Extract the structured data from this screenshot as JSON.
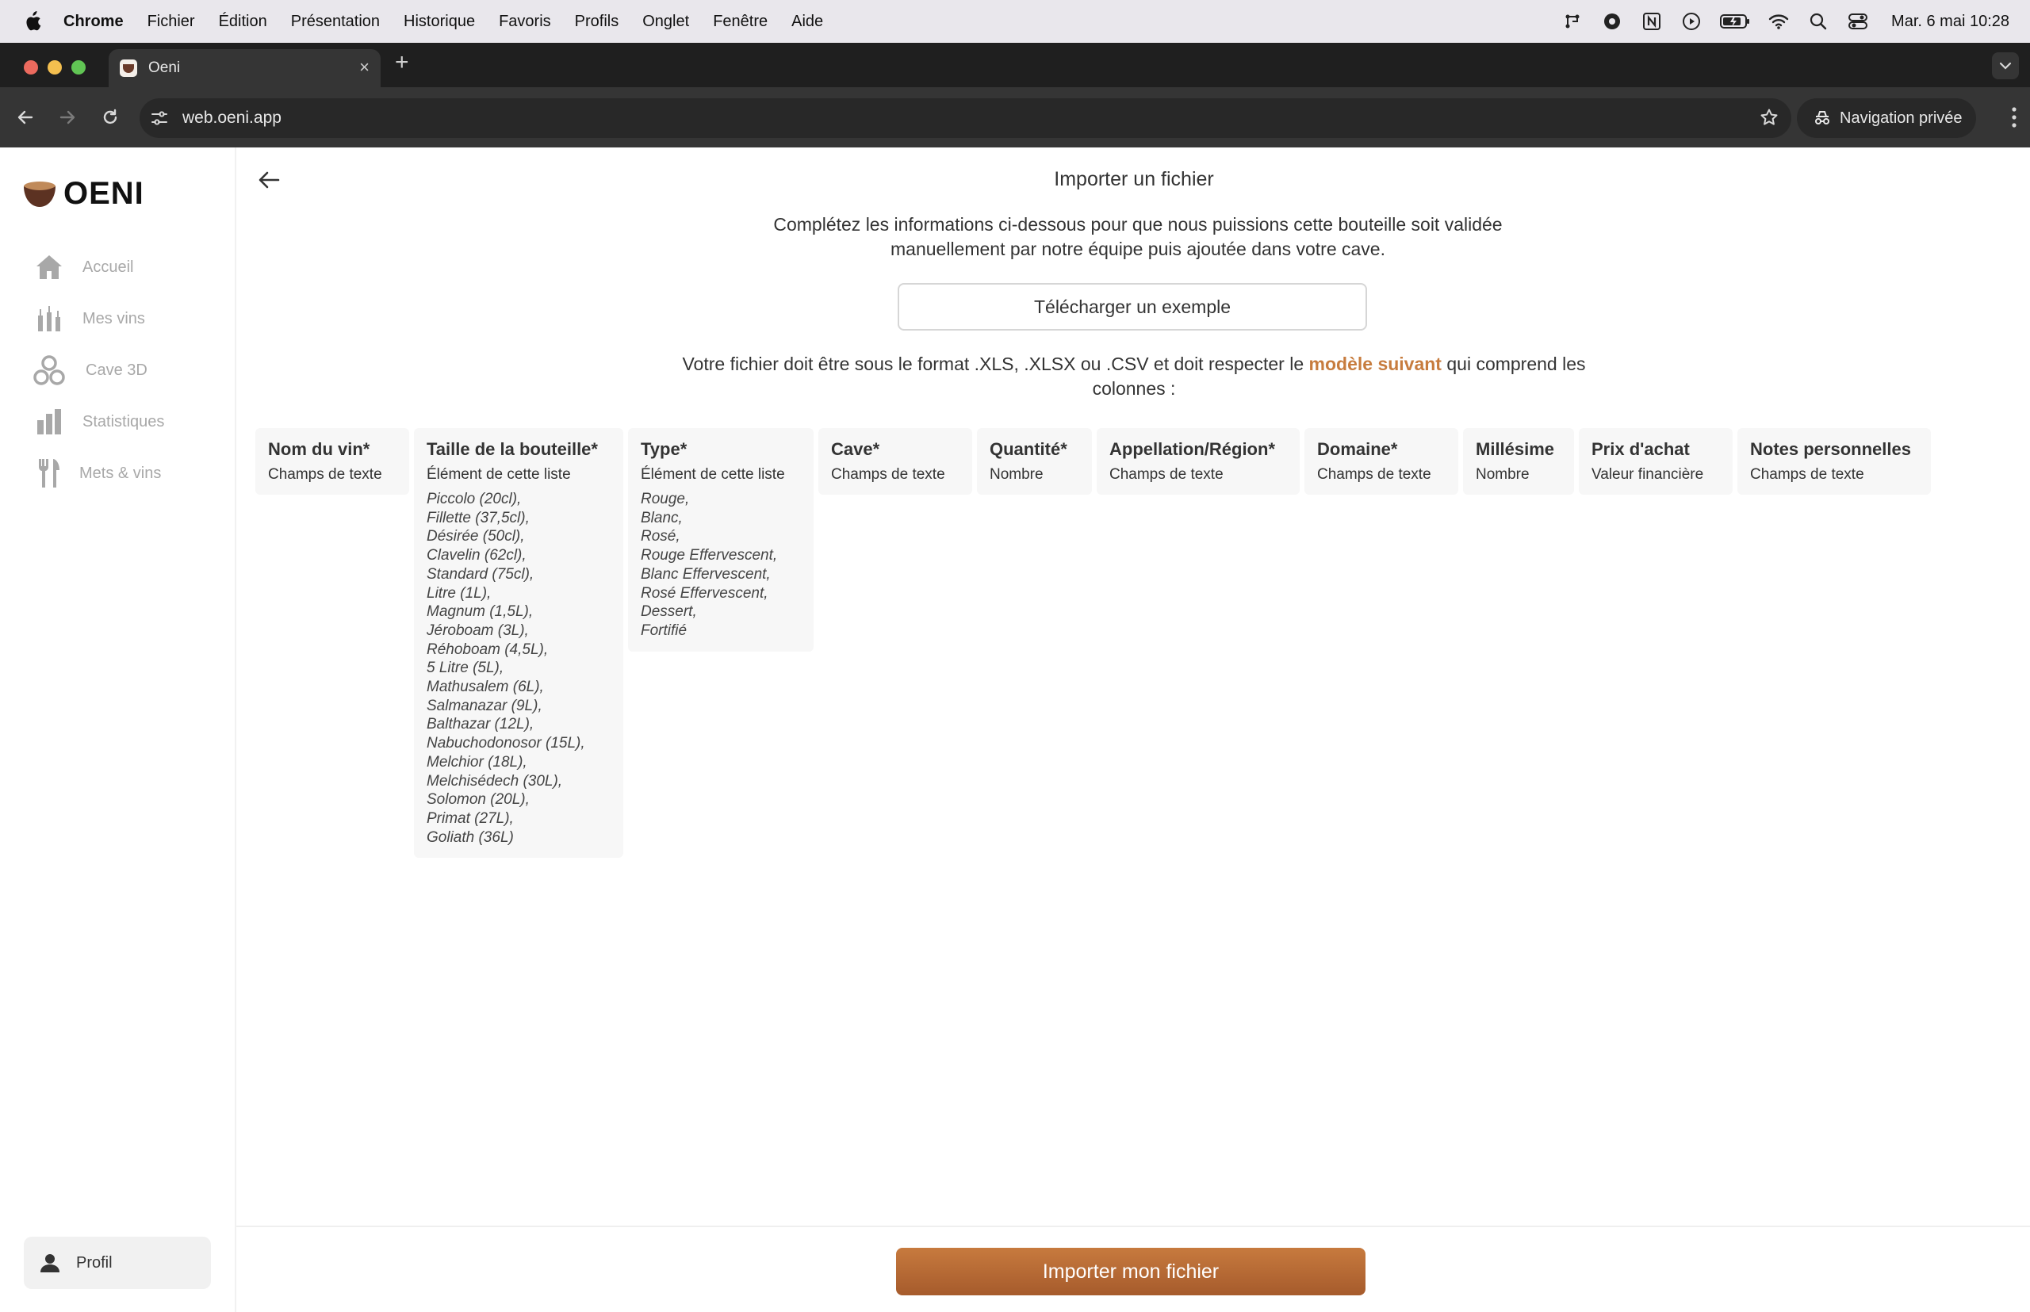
{
  "menubar": {
    "app": "Chrome",
    "items": [
      "Fichier",
      "Édition",
      "Présentation",
      "Historique",
      "Favoris",
      "Profils",
      "Onglet",
      "Fenêtre",
      "Aide"
    ],
    "clock": "Mar. 6 mai  10:28",
    "status_icons": [
      "hub-icon",
      "record-icon",
      "notion-icon",
      "play-icon",
      "battery-icon",
      "wifi-icon",
      "search-icon",
      "control-center-icon"
    ]
  },
  "browser": {
    "tab_title": "Oeni",
    "url": "web.oeni.app",
    "private_label": "Navigation privée"
  },
  "sidebar": {
    "logo_text": "OENI",
    "items": [
      {
        "label": "Accueil",
        "icon": "home-icon"
      },
      {
        "label": "Mes vins",
        "icon": "bottles-icon"
      },
      {
        "label": "Cave 3D",
        "icon": "cave-icon"
      },
      {
        "label": "Statistiques",
        "icon": "stats-icon"
      },
      {
        "label": "Mets & vins",
        "icon": "cutlery-icon"
      }
    ],
    "profile_label": "Profil"
  },
  "main": {
    "title": "Importer un fichier",
    "intro_line1": "Complétez les informations ci-dessous pour que nous puissions cette bouteille soit validée",
    "intro_line2": "manuellement par notre équipe puis ajoutée dans votre cave.",
    "example_button": "Télécharger un exemple",
    "format_before": "Votre fichier doit être sous le format .XLS, .XLSX ou .CSV et doit respecter le ",
    "format_link": "modèle suivant",
    "format_after": " qui comprend les colonnes :",
    "columns": [
      {
        "header": "Nom du vin*",
        "type": "Champs de texte"
      },
      {
        "header": "Taille de la bouteille*",
        "type": "Élément de cette liste"
      },
      {
        "header": "Type*",
        "type": "Élément de cette liste"
      },
      {
        "header": "Cave*",
        "type": "Champs de texte"
      },
      {
        "header": "Quantité*",
        "type": "Nombre"
      },
      {
        "header": "Appellation/Région*",
        "type": "Champs de texte"
      },
      {
        "header": "Domaine*",
        "type": "Champs de texte"
      },
      {
        "header": "Millésime",
        "type": "Nombre"
      },
      {
        "header": "Prix d'achat",
        "type": "Valeur financière"
      },
      {
        "header": "Notes personnelles",
        "type": "Champs de texte"
      }
    ],
    "bottle_sizes": [
      "Piccolo (20cl),",
      "Fillette (37,5cl),",
      "Désirée (50cl),",
      "Clavelin (62cl),",
      "Standard (75cl),",
      "Litre (1L),",
      "Magnum (1,5L),",
      "Jéroboam (3L),",
      "Réhoboam (4,5L),",
      "5 Litre (5L),",
      "Mathusalem (6L),",
      "Salmanazar (9L),",
      "Balthazar (12L),",
      "Nabuchodonosor (15L),",
      "Melchior (18L),",
      "Melchisédech (30L),",
      "Solomon (20L),",
      "Primat (27L),",
      "Goliath (36L)"
    ],
    "wine_types": [
      "Rouge,",
      "Blanc,",
      "Rosé,",
      "Rouge Effervescent,",
      "Blanc Effervescent,",
      "Rosé Effervescent,",
      "Dessert,",
      "Fortifié"
    ],
    "import_button": "Importer mon fichier"
  },
  "colors": {
    "accent": "#c77c3e",
    "button_gradient_top": "#c77a3e",
    "button_gradient_bottom": "#a65b2c",
    "logo_brown": "#6a3b2a"
  }
}
